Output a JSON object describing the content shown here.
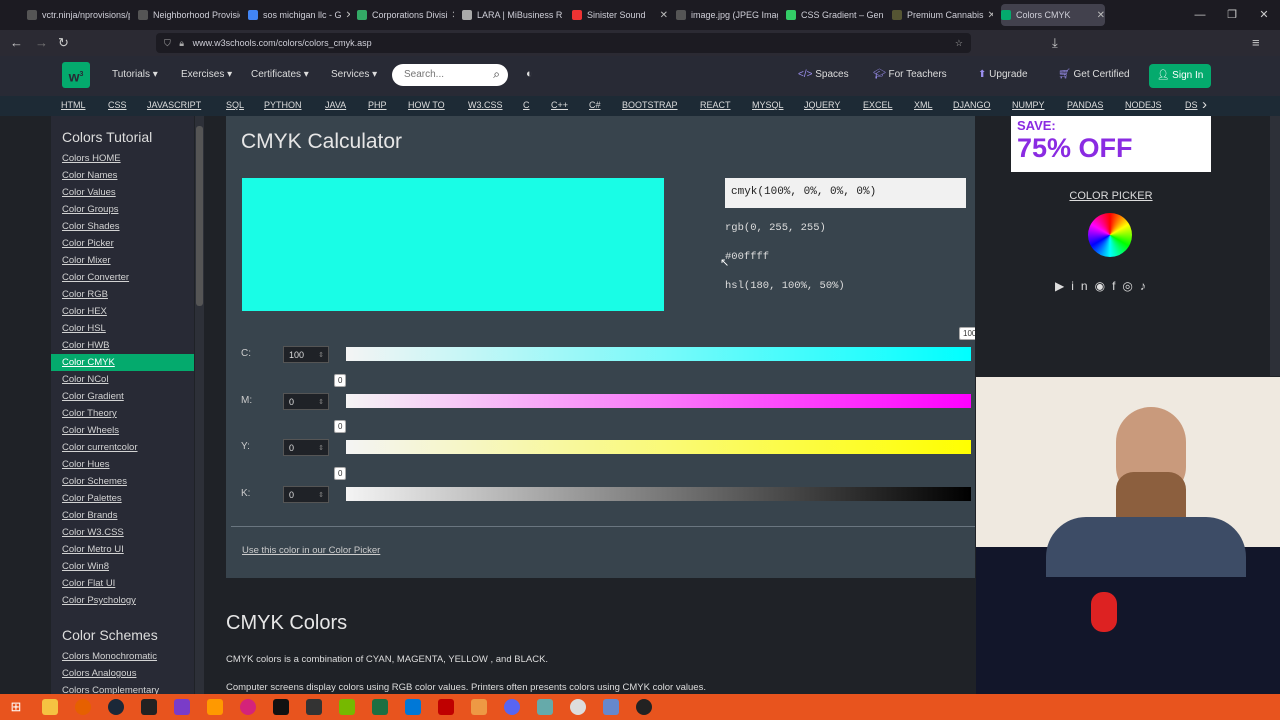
{
  "browser": {
    "tabs": [
      {
        "label": "vctr.ninja/nprovisions/p",
        "color": "#555"
      },
      {
        "label": "Neighborhood Provisio",
        "color": "#555"
      },
      {
        "label": "sos michigan llc - G",
        "color": "#4285f4"
      },
      {
        "label": "Corporations Divisi",
        "color": "#3a6"
      },
      {
        "label": "LARA | MiBusiness R",
        "color": "#aaa"
      },
      {
        "label": "Sinister Sound",
        "color": "#e33"
      },
      {
        "label": "image.jpg (JPEG Image",
        "color": "#555"
      },
      {
        "label": "CSS Gradient – Gen",
        "color": "#3c6"
      },
      {
        "label": "Premium Cannabis",
        "color": "#553"
      },
      {
        "label": "Colors CMYK",
        "color": "#04aa6d"
      }
    ],
    "url": "www.w3schools.com/colors/colors_cmyk.asp"
  },
  "header": {
    "tutorials": "Tutorials ▾",
    "exercises": "Exercises ▾",
    "certificates": "Certificates ▾",
    "services": "Services ▾",
    "search_placeholder": "Search...",
    "spaces": "Spaces",
    "for_teachers": "For Teachers",
    "upgrade": "Upgrade",
    "get_certified": "Get Certified",
    "sign_in": "Sign In"
  },
  "topnav": [
    "HTML",
    "CSS",
    "JAVASCRIPT",
    "SQL",
    "PYTHON",
    "JAVA",
    "PHP",
    "HOW TO",
    "W3.CSS",
    "C",
    "C++",
    "C#",
    "BOOTSTRAP",
    "REACT",
    "MYSQL",
    "JQUERY",
    "EXCEL",
    "XML",
    "DJANGO",
    "NUMPY",
    "PANDAS",
    "NODEJS",
    "DS"
  ],
  "sidebar": {
    "heading": "Colors Tutorial",
    "items": [
      "Colors HOME",
      "Color Names",
      "Color Values",
      "Color Groups",
      "Color Shades",
      "Color Picker",
      "Color Mixer",
      "Color Converter",
      "Color RGB",
      "Color HEX",
      "Color HSL",
      "Color HWB",
      "Color CMYK",
      "Color NCol",
      "Color Gradient",
      "Color Theory",
      "Color Wheels",
      "Color currentcolor",
      "Color Hues",
      "Color Schemes",
      "Color Palettes",
      "Color Brands",
      "Color W3.CSS",
      "Color Metro UI",
      "Color Win8",
      "Color Flat UI",
      "Color Psychology"
    ],
    "heading2": "Color Schemes",
    "items2": [
      "Colors Monochromatic",
      "Colors Analogous",
      "Colors Complementary"
    ],
    "active_index": 12
  },
  "calculator": {
    "title": "CMYK Calculator",
    "cmyk_value": "cmyk(100%, 0%, 0%, 0%)",
    "rgb": "rgb(0, 255, 255)",
    "hex": "#00ffff",
    "hsl": "hsl(180, 100%, 50%)",
    "swatch_color": "#19fde6",
    "sliders": [
      {
        "label": "C:",
        "value": "100",
        "tip": "100",
        "tip_fraction": 1.0
      },
      {
        "label": "M:",
        "value": "0",
        "tip": "0",
        "tip_fraction": 0.0
      },
      {
        "label": "Y:",
        "value": "0",
        "tip": "0",
        "tip_fraction": 0.0
      },
      {
        "label": "K:",
        "value": "0",
        "tip": "0",
        "tip_fraction": 0.0
      }
    ],
    "link": "Use this color in our Color Picker"
  },
  "section": {
    "title": "CMYK Colors",
    "p1": "CMYK colors is a combination of CYAN, MAGENTA, YELLOW , and BLACK.",
    "p2": "Computer screens display colors using RGB color values. Printers often presents colors using CMYK color values."
  },
  "ad": {
    "line1": "SAVE:",
    "line2": "75% OFF"
  },
  "color_picker": "COLOR PICKER"
}
